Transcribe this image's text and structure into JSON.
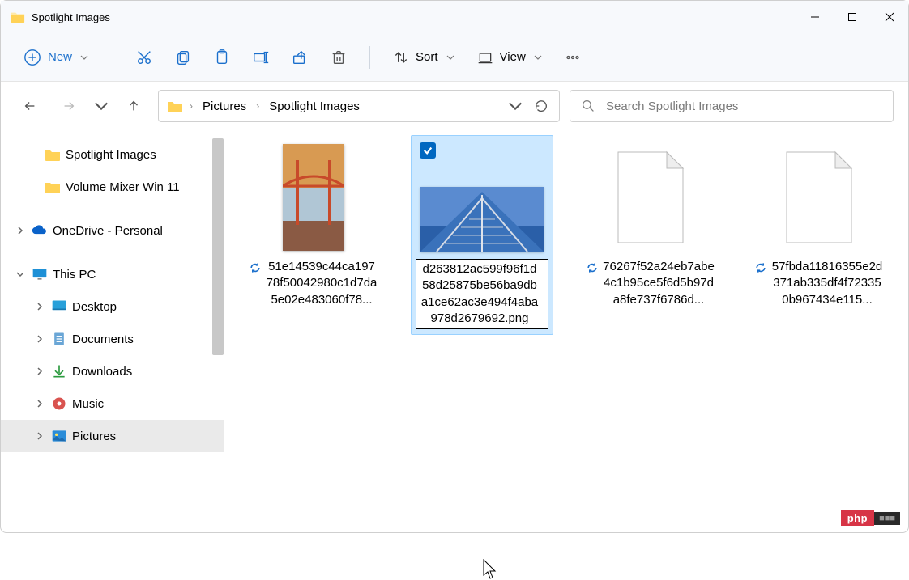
{
  "window": {
    "title": "Spotlight Images"
  },
  "ribbon": {
    "new_label": "New",
    "sort_label": "Sort",
    "view_label": "View"
  },
  "breadcrumb": {
    "seg1": "Pictures",
    "seg2": "Spotlight Images"
  },
  "search": {
    "placeholder": "Search Spotlight Images"
  },
  "sidebar": {
    "spotlight": "Spotlight Images",
    "volmix": "Volume Mixer Win 11",
    "onedrive": "OneDrive - Personal",
    "thispc": "This PC",
    "desktop": "Desktop",
    "documents": "Documents",
    "downloads": "Downloads",
    "music": "Music",
    "pictures": "Pictures"
  },
  "files": {
    "f1": "51e14539c44ca19778f50042980c1d7da5e02e483060f78...",
    "f2": "d263812ac599f96f1d58d25875be56ba9dba1ce62ac3e494f4aba978d2679692.png",
    "f3": "76267f52a24eb7abe4c1b95ce5f6d5b97da8fe737f6786d...",
    "f4": "57fbda11816355e2d371ab335df4f723350b967434e115..."
  },
  "badge": {
    "left": "php",
    "right": "■■■"
  }
}
